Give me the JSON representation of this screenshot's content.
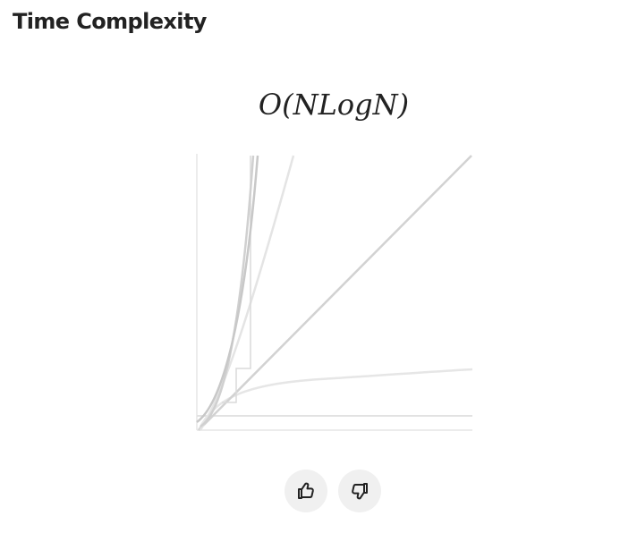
{
  "section": {
    "title": "Time Complexity"
  },
  "complexity": {
    "notation": "O(NLogN)",
    "curve_color": "#cfcfcf",
    "highlight_color": "#c2c2c2"
  },
  "feedback": {
    "like_icon": "thumbs-up-icon",
    "dislike_icon": "thumbs-down-icon",
    "button_bg": "#f0f0f0"
  }
}
